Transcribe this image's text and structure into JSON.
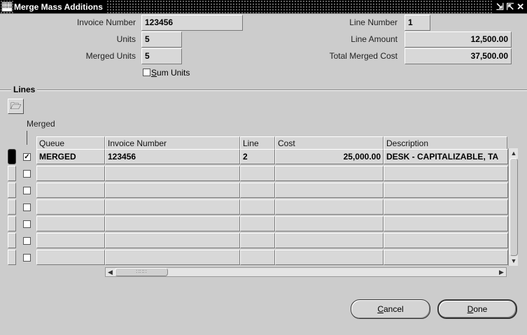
{
  "window": {
    "title": "Merge Mass Additions"
  },
  "header": {
    "invoice_number": {
      "label": "Invoice Number",
      "value": "123456"
    },
    "units": {
      "label": "Units",
      "value": "5"
    },
    "merged_units": {
      "label": "Merged Units",
      "value": "5"
    },
    "sum_units": {
      "label_mnemonic": "S",
      "label_rest": "um Units",
      "checked": false
    },
    "line_number": {
      "label": "Line Number",
      "value": "1"
    },
    "line_amount": {
      "label": "Line Amount",
      "value": "12,500.00"
    },
    "total_merged_cost": {
      "label": "Total Merged Cost",
      "value": "37,500.00"
    }
  },
  "lines": {
    "section_title": "Lines",
    "merged_label": "Merged",
    "columns": {
      "queue": "Queue",
      "invoice_number": "Invoice Number",
      "line": "Line",
      "cost": "Cost",
      "description": "Description"
    },
    "rows": [
      {
        "merged": true,
        "queue": "MERGED",
        "invoice_number": "123456",
        "line": "2",
        "cost": "25,000.00",
        "description": "DESK - CAPITALIZABLE, TA"
      },
      {
        "merged": false,
        "queue": "",
        "invoice_number": "",
        "line": "",
        "cost": "",
        "description": ""
      },
      {
        "merged": false,
        "queue": "",
        "invoice_number": "",
        "line": "",
        "cost": "",
        "description": ""
      },
      {
        "merged": false,
        "queue": "",
        "invoice_number": "",
        "line": "",
        "cost": "",
        "description": ""
      },
      {
        "merged": false,
        "queue": "",
        "invoice_number": "",
        "line": "",
        "cost": "",
        "description": ""
      },
      {
        "merged": false,
        "queue": "",
        "invoice_number": "",
        "line": "",
        "cost": "",
        "description": ""
      },
      {
        "merged": false,
        "queue": "",
        "invoice_number": "",
        "line": "",
        "cost": "",
        "description": ""
      }
    ]
  },
  "buttons": {
    "cancel": {
      "mnemonic": "C",
      "rest": "ancel"
    },
    "done": {
      "mnemonic": "D",
      "rest": "one"
    }
  },
  "icons": {
    "window_minimize": "minimize-icon",
    "window_close": "close-icon",
    "folder": "folder-icon"
  }
}
